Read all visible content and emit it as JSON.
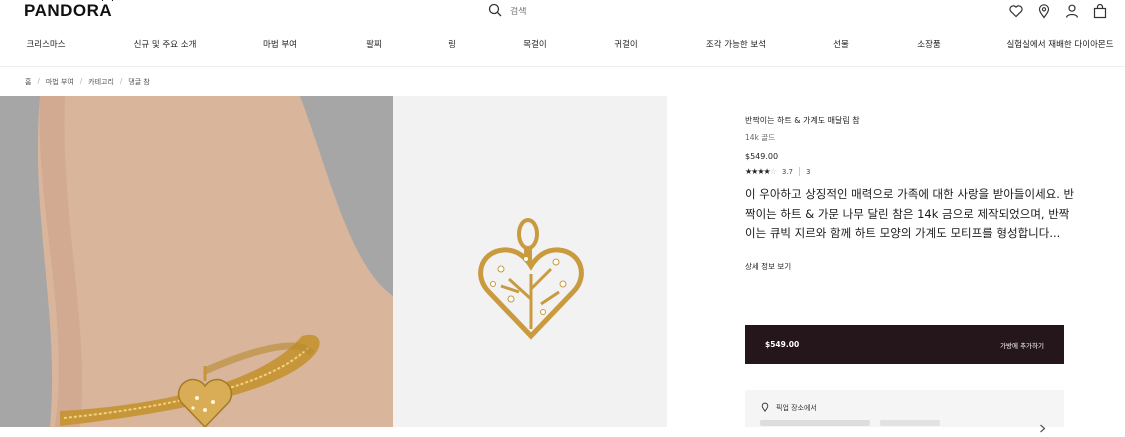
{
  "header": {
    "logo": "PANDORA",
    "search_placeholder": "검색"
  },
  "nav": {
    "items": [
      "크리스마스",
      "신규 및 주요 소개",
      "마법 부여",
      "팔찌",
      "링",
      "목걸이",
      "귀걸이",
      "조각 가능한 보석",
      "선물",
      "소장품",
      "실험실에서 재배한 다이아몬드"
    ]
  },
  "breadcrumb": [
    "홈",
    "마법 부여",
    "카테고리",
    "댕글 참"
  ],
  "product": {
    "title": "반짝이는 하트 & 가계도 매달림 참",
    "material": "14k 골드",
    "price": "$549.00",
    "rating": "3.7",
    "review_count": "3",
    "rating_value": 3.7,
    "description": "이 우아하고 상징적인 매력으로 가족에 대한 사랑을 받아들이세요. 반짝이는 하트 & 가문 나무 달린 참은 14k 금으로 제작되었으며, 반짝이는 큐빅 지르와 함께 하트 모양의 가계도 모티프를 형성합니다...",
    "more_link": "상세 정보 보기"
  },
  "cart": {
    "price": "$549.00",
    "label": "가방에 추가하기"
  },
  "store": {
    "heading": "픽업 장소에서"
  },
  "colors": {
    "cart_button": "#24161a",
    "photo_left_bg": "#a8a8a8",
    "photo_right_bg": "#f2f2f2",
    "gold": "#c99a3e"
  }
}
